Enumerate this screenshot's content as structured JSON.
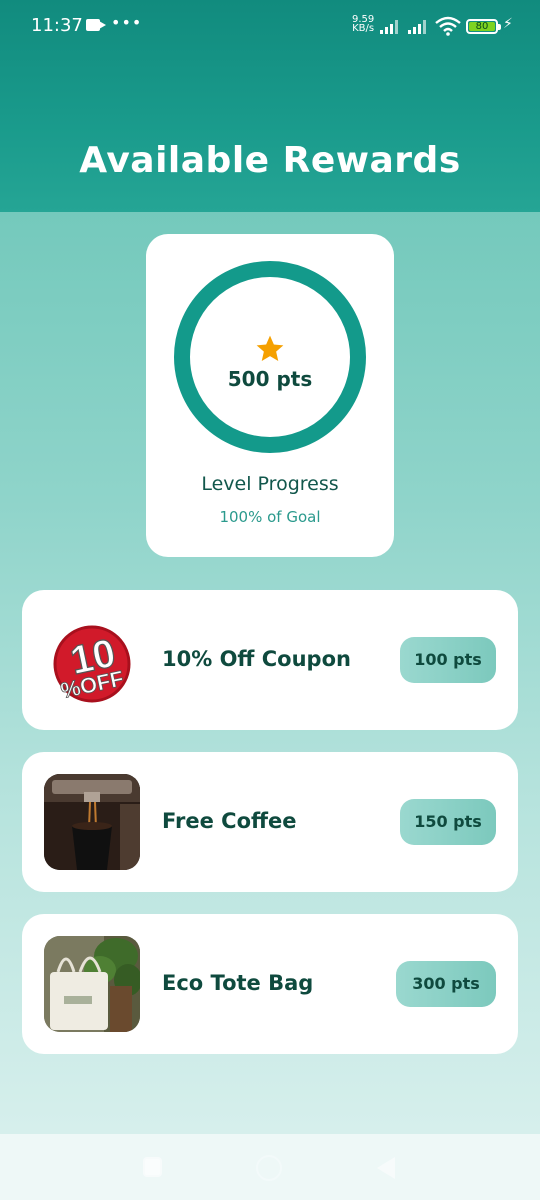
{
  "status_bar": {
    "time": "11:37",
    "dots": "•••",
    "speed_value": "9.59",
    "speed_unit": "KB/s",
    "battery": "80",
    "bolt": "⚡"
  },
  "header": {
    "title": "Available Rewards"
  },
  "progress": {
    "points": "500 pts",
    "level_label": "Level Progress",
    "goal_label": "100% of Goal",
    "ring_color": "#139a8b",
    "star_color": "#f5a000",
    "fraction": 1.0
  },
  "rewards": [
    {
      "name": "10% Off Coupon",
      "points": "100 pts",
      "icon": "discount-badge-image",
      "badge_top": "10",
      "badge_bottom": "%OFF"
    },
    {
      "name": "Free Coffee",
      "points": "150 pts",
      "icon": "coffee-cup-image"
    },
    {
      "name": "Eco Tote Bag",
      "points": "300 pts",
      "icon": "tote-bag-image"
    }
  ],
  "colors": {
    "header_bg": "#118b7e",
    "accent": "#139a8b",
    "text_dark": "#0f4a3e",
    "pts_pill": "#8fd1c7"
  }
}
